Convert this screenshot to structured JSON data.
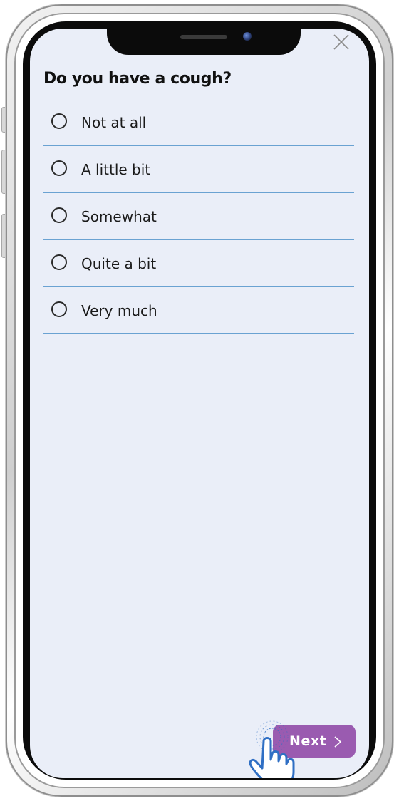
{
  "question": {
    "title": "Do you have a cough?"
  },
  "options": [
    {
      "label": "Not at all",
      "selected": false
    },
    {
      "label": "A little bit",
      "selected": false
    },
    {
      "label": "Somewhat",
      "selected": false
    },
    {
      "label": "Quite a bit",
      "selected": false
    },
    {
      "label": "Very much",
      "selected": false
    }
  ],
  "navigation": {
    "next_label": "Next",
    "next_icon": "chevron-right-icon",
    "close_icon": "close-icon"
  },
  "colors": {
    "screen_background": "#eaeef8",
    "divider": "#6aa2d2",
    "next_button": "#9a5bb0",
    "tap_hand_outline": "#2f6fc4"
  }
}
